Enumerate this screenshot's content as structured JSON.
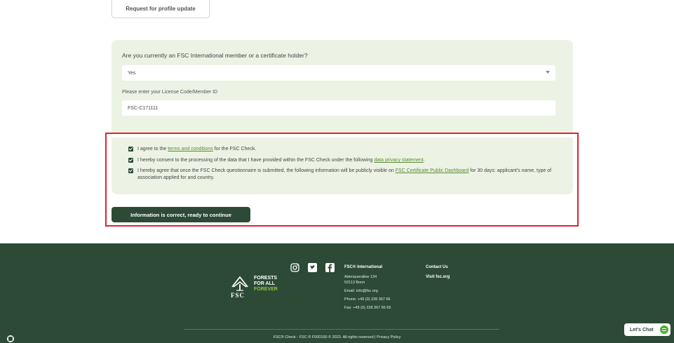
{
  "profile": {
    "request_button": "Request for profile update"
  },
  "membership": {
    "question": "Are you currently an FSC International member or a certificate holder?",
    "selected": "Yes",
    "license_label": "Please enter your License Code/Member ID",
    "license_value": "FSC-C171111"
  },
  "consent": {
    "terms_prefix": "I agree to the ",
    "terms_link": "terms and conditions",
    "terms_suffix": " for the FSC Check.",
    "privacy_prefix": "I hereby consent to the processing of the data that I have provided within the FSC Check under the following ",
    "privacy_link": "data privacy statement",
    "privacy_suffix": ".",
    "public_prefix": "I hereby agree that once the FSC Check questionnaire is submitted, the following information will be publicly visible on ",
    "public_link": "FSC Certificate Public Dashboard",
    "public_suffix": " for 30 days: applicant's name, type of association applied for and country."
  },
  "actions": {
    "continue_label": "Information is correct, ready to continue"
  },
  "footer": {
    "logo": {
      "line1": "FORESTS",
      "line2": "FOR ALL",
      "line3": "FOREVER",
      "mark": "FSC"
    },
    "intl": {
      "title": "FSC® International",
      "address1": "Adenauerallee 134",
      "address2": "53113 Bonn",
      "email": "Email: info@fsc.org",
      "phone": "Phone: +49 (0) 228 367 66",
      "fax": "Fax: +49 (0) 228 367 66 65"
    },
    "contact": {
      "title": "Contact Us",
      "visit": "Visit fsc.org"
    },
    "copyright": "FSC® Check - FSC ® F000100 © 2023. All rights reserved | Privacy Policy"
  },
  "chat": {
    "label": "Let's Chat"
  },
  "colors": {
    "brand_green": "#2c4a36",
    "panel_bg": "#ecf3e4",
    "highlight": "#d9262d",
    "chat_green": "#4caf2a"
  }
}
